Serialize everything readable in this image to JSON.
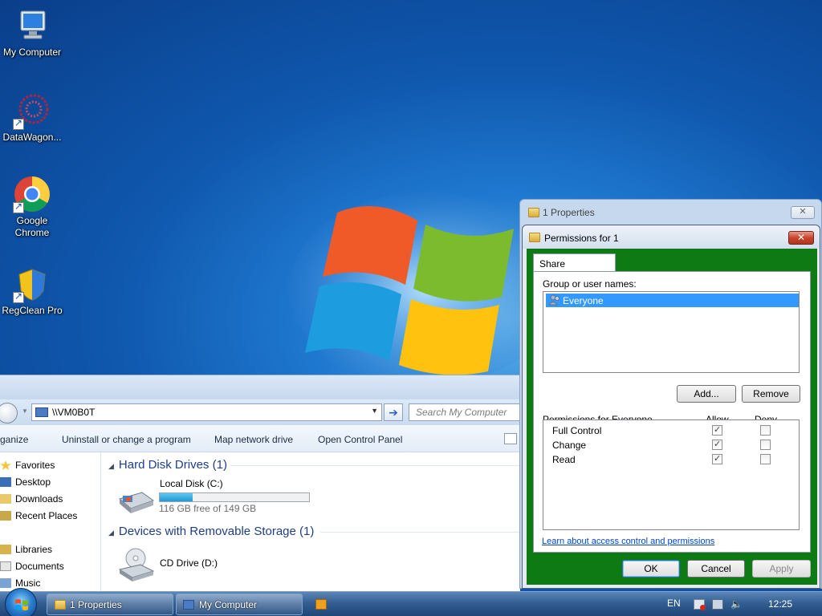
{
  "desktop": {
    "icons": [
      {
        "label": "My Computer",
        "icon": "computer-icon"
      },
      {
        "label": "DataWagon...",
        "icon": "datawagon-icon"
      },
      {
        "label": "Google Chrome",
        "icon": "chrome-icon"
      },
      {
        "label": "RegClean Pro",
        "icon": "regclean-icon"
      }
    ]
  },
  "explorer": {
    "address": "\\\\VM0B0T",
    "search_placeholder": "Search My Computer",
    "toolbar": {
      "organize": "ganize",
      "uninstall": "Uninstall or change a program",
      "map_drive": "Map network drive",
      "control_panel": "Open Control Panel"
    },
    "nav": {
      "favorites": "Favorites",
      "desktop": "Desktop",
      "downloads": "Downloads",
      "recent": "Recent Places",
      "libraries": "Libraries",
      "documents": "Documents",
      "music": "Music"
    },
    "groups": {
      "hard_disks": "Hard Disk Drives (1)",
      "removable": "Devices with Removable Storage (1)"
    },
    "local_disk": {
      "name": "Local Disk (C:)",
      "free": "116 GB free of 149 GB",
      "used_fraction": 0.22
    },
    "cd_drive": {
      "name": "CD Drive (D:)"
    }
  },
  "properties_window": {
    "title": "1 Properties",
    "close": "✕"
  },
  "permissions_dialog": {
    "title": "Permissions for 1",
    "close": "✕",
    "tab": "Share Permissions",
    "group_label": "Group or user names:",
    "users": [
      "Everyone"
    ],
    "add_button": "Add...",
    "remove_button": "Remove",
    "permissions_header": "Permissions for Everyone",
    "allow_header": "Allow",
    "deny_header": "Deny",
    "permissions": [
      {
        "name": "Full Control",
        "allow": true,
        "deny": false
      },
      {
        "name": "Change",
        "allow": true,
        "deny": false
      },
      {
        "name": "Read",
        "allow": true,
        "deny": false
      }
    ],
    "link": "Learn about access control and permissions",
    "ok_button": "OK",
    "cancel_button": "Cancel",
    "apply_button": "Apply",
    "accent_color": "#0e7a14"
  },
  "taskbar": {
    "buttons": [
      {
        "label": "1 Properties"
      },
      {
        "label": "My Computer"
      }
    ],
    "language": "EN",
    "clock": "12:25"
  }
}
